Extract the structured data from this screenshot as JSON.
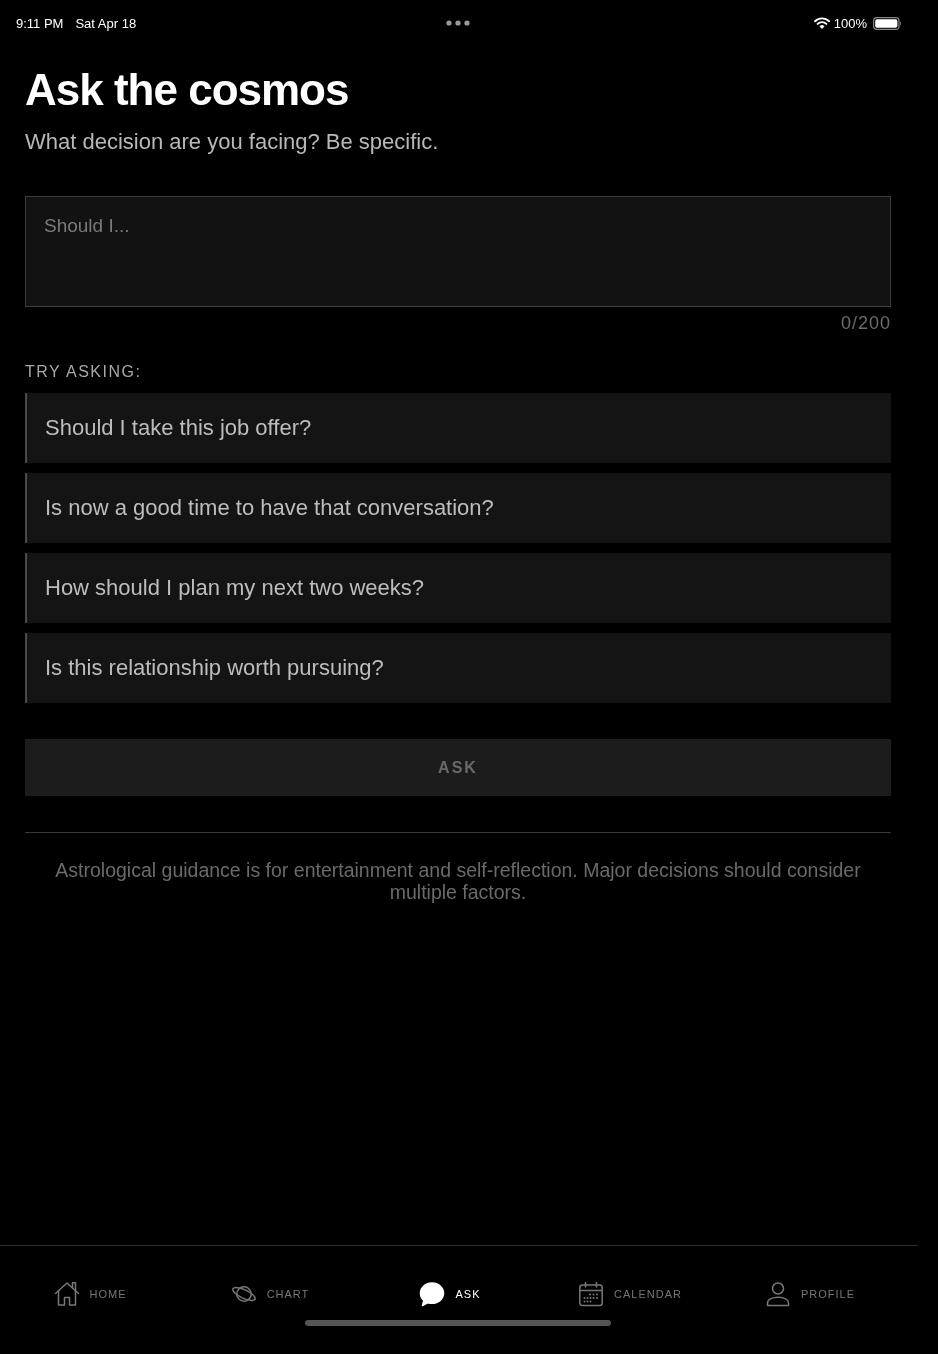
{
  "status_bar": {
    "time": "9:11 PM",
    "date": "Sat Apr 18",
    "battery": "100%"
  },
  "header": {
    "title": "Ask the cosmos",
    "subtitle": "What decision are you facing? Be specific."
  },
  "question_field": {
    "placeholder": "Should I...",
    "counter": "0/200"
  },
  "suggestions": {
    "heading": "TRY ASKING:",
    "items": [
      "Should I take this job offer?",
      "Is now a good time to have that conversation?",
      "How should I plan my next two weeks?",
      "Is this relationship worth pursuing?"
    ]
  },
  "ask_button": {
    "label": "ASK",
    "disabled": true
  },
  "disclaimer": "Astrological guidance is for entertainment and self-reflection. Major decisions should consider multiple factors.",
  "tab_bar": [
    {
      "label": "HOME",
      "selected": false
    },
    {
      "label": "CHART",
      "selected": false
    },
    {
      "label": "ASK",
      "selected": true
    },
    {
      "label": "CALENDAR",
      "selected": false
    },
    {
      "label": "PROFILE",
      "selected": false
    }
  ]
}
